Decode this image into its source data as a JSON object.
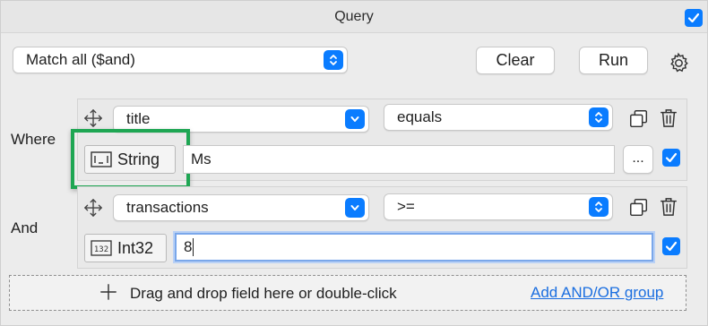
{
  "window": {
    "title": "Query",
    "enabled": true
  },
  "toolbar": {
    "match_mode": "Match all ($and)",
    "clear_label": "Clear",
    "run_label": "Run",
    "settings_icon": "gear-icon"
  },
  "conditions": [
    {
      "row_label": "Where",
      "field": "title",
      "operator": "equals",
      "value_type": "String",
      "value": "Ms",
      "more_label": "...",
      "enabled": true
    },
    {
      "row_label": "And",
      "field": "transactions",
      "operator": ">=",
      "value_type": "Int32",
      "value": "8",
      "enabled": true
    }
  ],
  "dropzone": {
    "hint": "Drag and drop field here or double-click",
    "add_group_link": "Add AND/OR group"
  },
  "colors": {
    "accent": "#0a7cff",
    "highlight": "#1ea653",
    "link": "#1a6ee0"
  }
}
